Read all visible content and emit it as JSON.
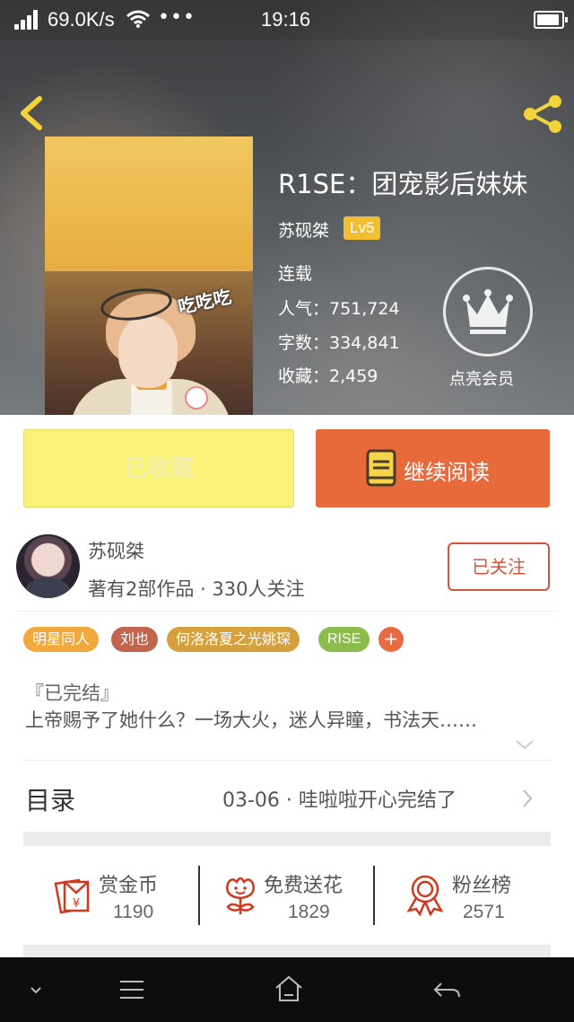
{
  "status_bar": {
    "net_speed": "69.0K/s",
    "dots": "•••",
    "time": "19:16"
  },
  "book": {
    "title": "R1SE：团宠影后妹妹",
    "author": "苏砚桀",
    "level": "Lv5",
    "status": "连载",
    "popularity": "人气：751,724",
    "words": "字数：334,841",
    "favorites": "收藏：2,459",
    "cover_sticker": "吃吃吃"
  },
  "member": {
    "label": "点亮会员"
  },
  "actions": {
    "collect_label": "已收藏",
    "read_label": "继续阅读"
  },
  "author_row": {
    "name": "苏砚桀",
    "meta": "著有2部作品 · 330人关注",
    "follow_label": "已关注"
  },
  "tags": [
    "明星同人",
    "刘也",
    "何洛洛夏之光姚琛",
    "RISE"
  ],
  "tag_more": "+",
  "intro": {
    "status": "『已完结』",
    "text": "上帝赐予了她什么？一场大火，迷人异瞳，书法天……"
  },
  "catalog": {
    "title": "目录",
    "latest": "03-06 · 哇啦啦开心完结了"
  },
  "stats": {
    "coins_label": "赏金币",
    "coins_value": "1190",
    "flower_label": "免费送花",
    "flower_value": "1829",
    "fans_label": "粉丝榜",
    "fans_value": "2571"
  },
  "colors": {
    "accent_orange": "#e8693a",
    "collect_yellow": "#fbf27a",
    "level_badge": "#f2bf30",
    "follow_red": "#d9533c",
    "icon_red": "#d0391f",
    "nav_icon_yellow": "#f5d33a"
  },
  "icons": {
    "back": "chevron-left-icon",
    "share": "share-icon",
    "member": "crown-icon",
    "read": "book-icon",
    "expand": "chevron-down-icon",
    "catalog": "chevron-right-icon",
    "coins": "red-envelope-yen-icon",
    "flower": "flower-icon",
    "fans": "award-ribbon-icon"
  }
}
